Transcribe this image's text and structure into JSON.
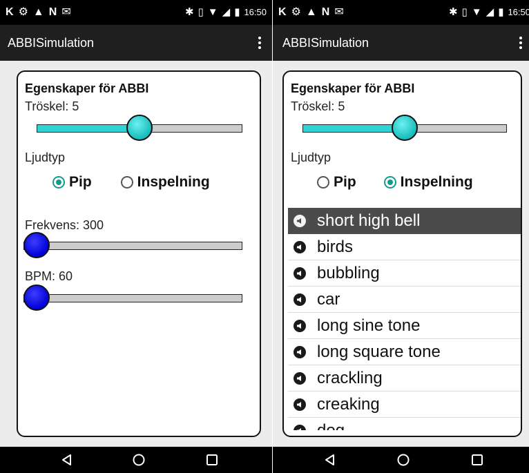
{
  "status_bar": {
    "left_icons": [
      "K",
      "⚙",
      "▲",
      "N",
      "✉"
    ],
    "bluetooth": "✱",
    "vibrate": "▯",
    "wifi": "▼",
    "signal": "◢",
    "battery": "▮",
    "time": "16:50"
  },
  "app": {
    "title": "ABBISimulation"
  },
  "left_screen": {
    "section_title": "Egenskaper för ABBI",
    "threshold_label": "Tröskel: 5",
    "threshold_value": 5,
    "threshold_fraction": 0.5,
    "sound_type_label": "Ljudtyp",
    "radio_options": [
      {
        "label": "Pip",
        "checked": true
      },
      {
        "label": "Inspelning",
        "checked": false
      }
    ],
    "frequency_label": "Frekvens: 300",
    "frequency_fraction": 0.0,
    "bpm_label": "BPM: 60",
    "bpm_fraction": 0.0
  },
  "right_screen": {
    "section_title": "Egenskaper för ABBI",
    "threshold_label": "Tröskel: 5",
    "threshold_fraction": 0.5,
    "sound_type_label": "Ljudtyp",
    "radio_options": [
      {
        "label": "Pip",
        "checked": false
      },
      {
        "label": "Inspelning",
        "checked": true
      }
    ],
    "sounds": [
      {
        "label": "short high bell",
        "selected": true
      },
      {
        "label": "birds",
        "selected": false
      },
      {
        "label": "bubbling",
        "selected": false
      },
      {
        "label": "car",
        "selected": false
      },
      {
        "label": "long sine tone",
        "selected": false
      },
      {
        "label": "long square tone",
        "selected": false
      },
      {
        "label": "crackling",
        "selected": false
      },
      {
        "label": "creaking",
        "selected": false
      },
      {
        "label": "dog",
        "selected": false
      }
    ]
  },
  "colors": {
    "accent": "#0f9d8a",
    "slider_fill": "#2fd3d3",
    "slider_thumb_blue": "#0000d8",
    "action_bar": "#1f1f1f",
    "selected_row": "#4b4b4b"
  },
  "icons": {
    "overflow": "more-vert-icon",
    "sound": "speaker-icon",
    "nav_back": "back-triangle-icon",
    "nav_home": "home-circle-icon",
    "nav_recents": "recents-square-icon"
  }
}
